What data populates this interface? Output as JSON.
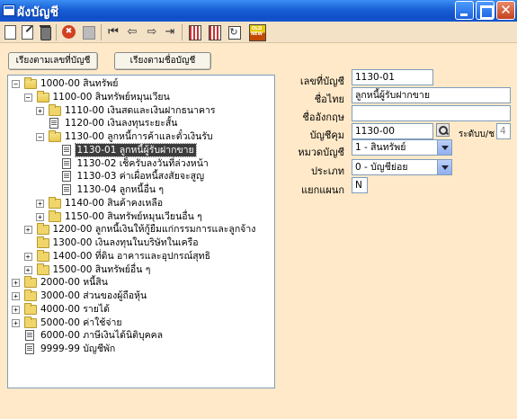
{
  "window": {
    "title": "ผังบัญชี"
  },
  "toolbar": {
    "oldnew_label": "OLD NEW",
    "arrows": {
      "first": "⏮",
      "prev": "⇦",
      "next": "⇨",
      "last": "⇥"
    }
  },
  "sort_buttons": {
    "by_number": "เรียงตามเลขที่บัญชี",
    "by_name": "เรียงตามชื่อบัญชี"
  },
  "tree": {
    "selected": "1130-01 ลูกหนี้ผู้รับฝากขาย",
    "items": [
      {
        "label": "1000-00 สินทรัพย์",
        "level": 0,
        "node": "folder-open",
        "expander": "minus"
      },
      {
        "label": "1100-00 สินทรัพย์หมุนเวียน",
        "level": 1,
        "node": "folder-open",
        "expander": "minus"
      },
      {
        "label": "1110-00 เงินสดและเงินฝากธนาคาร",
        "level": 2,
        "node": "folder",
        "expander": "plus"
      },
      {
        "label": "1120-00 เงินลงทุนระยะสั้น",
        "level": 2,
        "node": "leaf",
        "expander": ""
      },
      {
        "label": "1130-00 ลูกหนี้การค้าและตั๋วเงินรับ",
        "level": 2,
        "node": "folder-open",
        "expander": "minus"
      },
      {
        "label": "1130-01 ลูกหนี้ผู้รับฝากขาย",
        "level": 3,
        "node": "leaf",
        "expander": ""
      },
      {
        "label": "1130-02 เช็ครับลงวันที่ล่วงหน้า",
        "level": 3,
        "node": "leaf",
        "expander": ""
      },
      {
        "label": "1130-03 ค่าเผื่อหนี้สงสัยจะสูญ",
        "level": 3,
        "node": "leaf",
        "expander": ""
      },
      {
        "label": "1130-04 ลูกหนี้อื่น ๆ",
        "level": 3,
        "node": "leaf",
        "expander": ""
      },
      {
        "label": "1140-00 สินค้าคงเหลือ",
        "level": 2,
        "node": "folder",
        "expander": "plus"
      },
      {
        "label": "1150-00 สินทรัพย์หมุนเวียนอื่น ๆ",
        "level": 2,
        "node": "folder",
        "expander": "plus"
      },
      {
        "label": "1200-00 ลูกหนี้เงินให้กู้ยืมแก่กรรมการและลูกจ้าง",
        "level": 1,
        "node": "folder",
        "expander": "plus"
      },
      {
        "label": "1300-00 เงินลงทุนในบริษัทในเครือ",
        "level": 1,
        "node": "folder",
        "expander": ""
      },
      {
        "label": "1400-00 ที่ดิน อาคารและอุปกรณ์สุทธิ",
        "level": 1,
        "node": "folder",
        "expander": "plus"
      },
      {
        "label": "1500-00 สินทรัพย์อื่น ๆ",
        "level": 1,
        "node": "folder",
        "expander": "plus"
      },
      {
        "label": "2000-00 หนี้สิน",
        "level": 0,
        "node": "folder",
        "expander": "plus"
      },
      {
        "label": "3000-00 ส่วนของผู้ถือหุ้น",
        "level": 0,
        "node": "folder",
        "expander": "plus"
      },
      {
        "label": "4000-00 รายได้",
        "level": 0,
        "node": "folder",
        "expander": "plus"
      },
      {
        "label": "5000-00 ค่าใช้จ่าย",
        "level": 0,
        "node": "folder",
        "expander": "plus"
      },
      {
        "label": "6000-00 ภาษีเงินได้นิติบุคคล",
        "level": 0,
        "node": "leaf",
        "expander": ""
      },
      {
        "label": "9999-99 บัญชีพัก",
        "level": 0,
        "node": "leaf",
        "expander": ""
      }
    ]
  },
  "form": {
    "account_no": {
      "label": "เลขที่บัญชี",
      "value": "1130-01"
    },
    "thai_name": {
      "label": "ชื่อไทย",
      "value": "ลูกหนี้ผู้รับฝากขาย"
    },
    "english_name": {
      "label": "ชื่ออังกฤษ",
      "value": ""
    },
    "parent_account": {
      "label": "บัญชีคุม",
      "value": "1130-00"
    },
    "level": {
      "label": "ระดับบ/ช",
      "value": "4"
    },
    "category": {
      "label": "หมวดบัญชี",
      "value": "1 - สินทรัพย์"
    },
    "type": {
      "label": "ประเภท",
      "value": "0 - บัญชีย่อย"
    },
    "by_department": {
      "label": "แยกแผนก",
      "value": "N"
    }
  }
}
